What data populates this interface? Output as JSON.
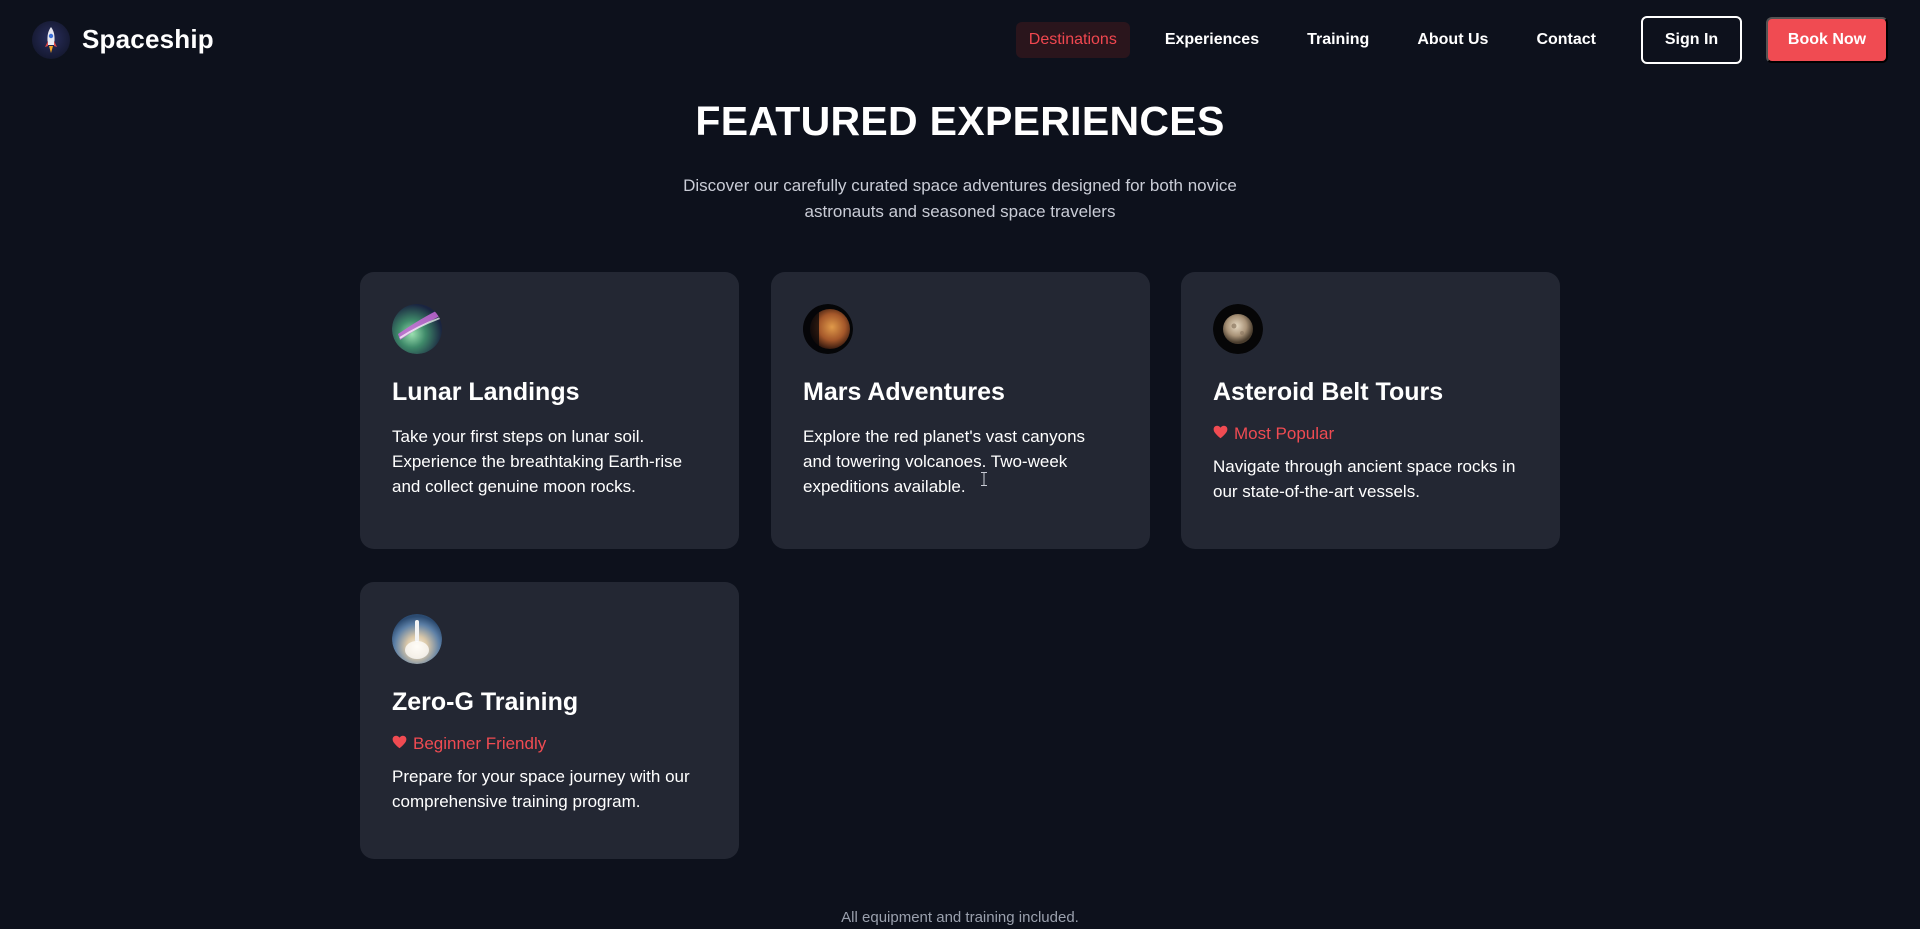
{
  "brand": {
    "name": "Spaceship",
    "logo_icon": "rocket-icon"
  },
  "nav": {
    "links": [
      {
        "label": "Destinations",
        "active": true
      },
      {
        "label": "Experiences",
        "active": false
      },
      {
        "label": "Training",
        "active": false
      },
      {
        "label": "About Us",
        "active": false
      },
      {
        "label": "Contact",
        "active": false
      }
    ],
    "sign_in": "Sign In",
    "book_now": "Book Now"
  },
  "hero": {
    "title": "FEATURED EXPERIENCES",
    "subtitle": "Discover our carefully curated space adventures designed for both novice astronauts and seasoned space travelers"
  },
  "cards": [
    {
      "title": "Lunar Landings",
      "badge": "",
      "description": "Take your first steps on lunar soil. Experience the breathtaking Earth-rise and collect genuine moon rocks.",
      "icon": "aurora-planet-icon"
    },
    {
      "title": "Mars Adventures",
      "badge": "",
      "description": "Explore the red planet's vast canyons and towering volcanoes. Two-week expeditions available.",
      "icon": "mars-icon"
    },
    {
      "title": "Asteroid Belt Tours",
      "badge": "Most Popular",
      "description": "Navigate through ancient space rocks in our state-of-the-art vessels.",
      "icon": "asteroid-icon"
    },
    {
      "title": "Zero-G Training",
      "badge": "Beginner Friendly",
      "description": "Prepare for your space journey with our comprehensive training program.",
      "icon": "rocket-launch-icon"
    }
  ],
  "footer": {
    "note": "All equipment and training included."
  },
  "colors": {
    "background": "#0d111c",
    "card": "#232733",
    "accent": "#f04b52"
  }
}
